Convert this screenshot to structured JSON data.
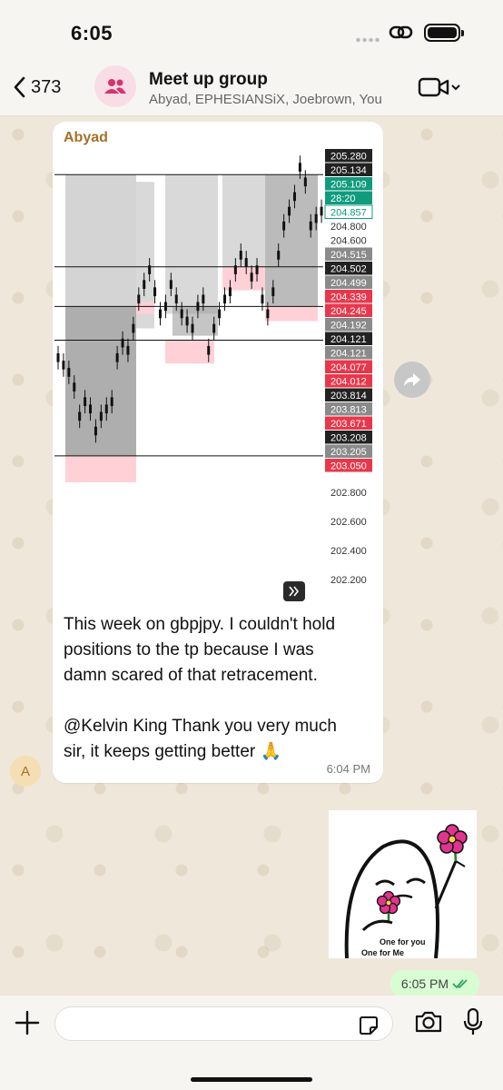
{
  "status": {
    "time": "6:05"
  },
  "header": {
    "back_count": "373",
    "title": "Meet up group",
    "members": "Abyad, EPHESIANSiX, Joebrown, You"
  },
  "message_in": {
    "sender": "Abyad",
    "sender_initial": "A",
    "lines": [
      "This week on gbpjpy. I couldn't hold",
      "positions to the tp because I was",
      "damn scared of that retracement.",
      "",
      "@Kelvin King Thank you very much",
      "sir, it keeps getting better 🙏"
    ],
    "time": "6:04 PM",
    "chart_expand_icon": "chevron-double-right-icon"
  },
  "chart_data": {
    "type": "candlestick",
    "symbol_shown": "gbpjpy",
    "y_axis_ticks": [
      "205.280",
      "205.134",
      "205.109",
      "28:20",
      "204.857",
      "204.800",
      "204.600",
      "204.515",
      "204.502",
      "204.499",
      "204.339",
      "204.245",
      "204.192",
      "204.121",
      "204.121",
      "204.077",
      "204.012",
      "203.814",
      "203.813",
      "203.671",
      "203.208",
      "203.205",
      "203.050",
      "202.800",
      "202.600",
      "202.400",
      "202.200"
    ],
    "price_labels": [
      {
        "text": "205.280",
        "style": "dark"
      },
      {
        "text": "205.134",
        "style": "dark"
      },
      {
        "text": "205.109",
        "style": "teal"
      },
      {
        "text": "28:20",
        "style": "teal"
      },
      {
        "text": "204.857",
        "style": "outline"
      },
      {
        "text": "204.800",
        "style": "plain"
      },
      {
        "text": "204.600",
        "style": "plain"
      },
      {
        "text": "204.515",
        "style": "gray"
      },
      {
        "text": "204.502",
        "style": "dark"
      },
      {
        "text": "204.499",
        "style": "gray"
      },
      {
        "text": "204.339",
        "style": "red"
      },
      {
        "text": "204.245",
        "style": "red"
      },
      {
        "text": "204.192",
        "style": "gray"
      },
      {
        "text": "204.121",
        "style": "dark"
      },
      {
        "text": "204.121",
        "style": "gray"
      },
      {
        "text": "204.077",
        "style": "red"
      },
      {
        "text": "204.012",
        "style": "red"
      },
      {
        "text": "203.814",
        "style": "dark"
      },
      {
        "text": "203.813",
        "style": "gray"
      },
      {
        "text": "203.671",
        "style": "red"
      },
      {
        "text": "203.208",
        "style": "dark"
      },
      {
        "text": "203.205",
        "style": "gray"
      },
      {
        "text": "203.050",
        "style": "red"
      },
      {
        "text": "202.800",
        "style": "plain"
      },
      {
        "text": "202.600",
        "style": "plain"
      },
      {
        "text": "202.400",
        "style": "plain"
      },
      {
        "text": "202.200",
        "style": "plain"
      }
    ],
    "ylim": [
      202.2,
      205.3
    ],
    "horizontal_levels": [
      205.15,
      204.52,
      204.25,
      204.02,
      203.23
    ],
    "colors": {
      "dark": "#222222",
      "gray": "#8a8a8a",
      "red": "#e8374b",
      "teal": "#119b7d",
      "zone_gray": "#c9c9c9",
      "zone_pink": "#ffd0d6"
    }
  },
  "sticker": {
    "caption_1": "One for you",
    "caption_2": "One for  Me"
  },
  "message_out": {
    "time": "6:05 PM",
    "status_icon": "double-check-icon"
  },
  "composer": {
    "placeholder": ""
  },
  "colors": {
    "accent_in_name": "#a66f27",
    "outgoing_bubble": "#d9fdd3",
    "avatar_group": "#f8dde6"
  }
}
